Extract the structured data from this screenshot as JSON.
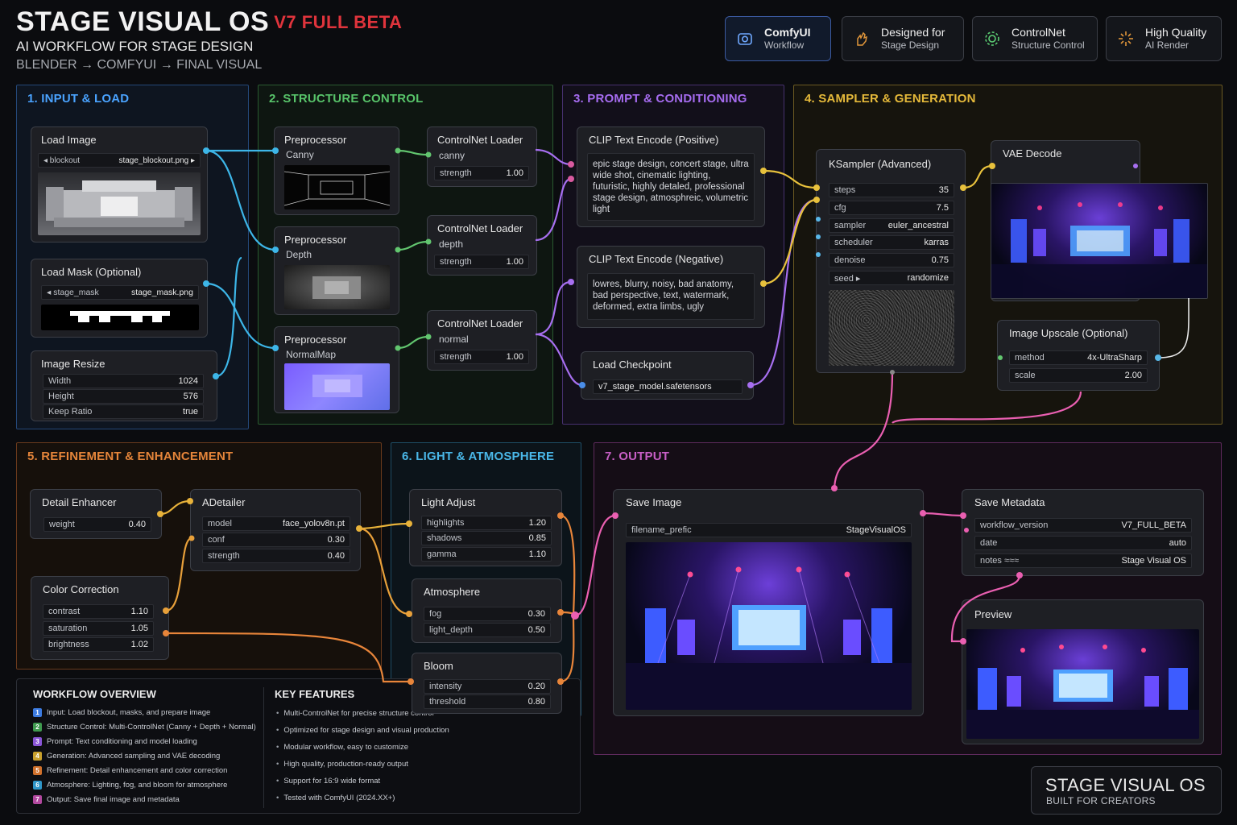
{
  "header": {
    "title": "STAGE VISUAL OS",
    "beta": "V7 FULL BETA",
    "subtitle": "AI WORKFLOW FOR STAGE DESIGN",
    "pipeline": "BLENDER → COMFYUI → FINAL VISUAL"
  },
  "badges": [
    {
      "title": "ComfyUI",
      "sub": "Workflow",
      "icon": "camera-icon"
    },
    {
      "title": "Designed for",
      "sub": "Stage Design",
      "icon": "hand-icon"
    },
    {
      "title": "ControlNet",
      "sub": "Structure Control",
      "icon": "gear-icon"
    },
    {
      "title": "High Quality",
      "sub": "AI Render",
      "icon": "sparkle-icon"
    }
  ],
  "sections": {
    "s1": "1. INPUT & LOAD",
    "s2": "2. STRUCTURE CONTROL",
    "s3": "3. PROMPT & CONDITIONING",
    "s4": "4. SAMPLER & GENERATION",
    "s5": "5. REFINEMENT & ENHANCEMENT",
    "s6": "6. LIGHT & ATMOSPHERE",
    "s7": "7. OUTPUT"
  },
  "colors": {
    "s1": "#4aa3ff",
    "s2": "#58c46a",
    "s3": "#a66cf0",
    "s4": "#e5b93a",
    "s5": "#e5853a",
    "s6": "#4ab7e8",
    "s7": "#c85fc6"
  },
  "nodes": {
    "load_image": {
      "title": "Load Image",
      "left": "◂ blockout",
      "file": "stage_blockout.png ▸"
    },
    "load_mask": {
      "title": "Load Mask (Optional)",
      "left": "◂ stage_mask",
      "file": "stage_mask.png"
    },
    "image_resize": {
      "title": "Image Resize",
      "rows": [
        [
          "Width",
          "1024"
        ],
        [
          "Height",
          "576"
        ],
        [
          "Keep Ratio",
          "true"
        ]
      ]
    },
    "pre_canny": {
      "title": "Preprocessor",
      "sub": "Canny"
    },
    "pre_depth": {
      "title": "Preprocessor",
      "sub": "Depth"
    },
    "pre_normal": {
      "title": "Preprocessor",
      "sub": "NormalMap"
    },
    "cn_canny": {
      "title": "ControlNet Loader",
      "sub": "canny",
      "k": "strength",
      "v": "1.00"
    },
    "cn_depth": {
      "title": "ControlNet Loader",
      "sub": "depth",
      "k": "strength",
      "v": "1.00"
    },
    "cn_normal": {
      "title": "ControlNet Loader",
      "sub": "normal",
      "k": "strength",
      "v": "1.00"
    },
    "clip_pos": {
      "title": "CLIP Text Encode (Positive)",
      "text": "epic stage design, concert stage, ultra wide shot, cinematic lighting, futuristic, highly detaled, professional stage design, atmosphreic, volumetric light"
    },
    "clip_neg": {
      "title": "CLIP Text Encode (Negative)",
      "text": "lowres, blurry, noisy, bad anatomy, bad perspective, text, watermark, deformed, extra limbs, ugly"
    },
    "checkpoint": {
      "title": "Load Checkpoint",
      "value": "v7_stage_model.safetensors"
    },
    "ksampler": {
      "title": "KSampler (Advanced)",
      "rows": [
        [
          "steps",
          "35"
        ],
        [
          "cfg",
          "7.5"
        ],
        [
          "sampler",
          "euler_ancestral"
        ],
        [
          "scheduler",
          "karras"
        ],
        [
          "denoise",
          "0.75"
        ],
        [
          "seed ▸",
          "randomize"
        ]
      ]
    },
    "vae": {
      "title": "VAE Decode"
    },
    "upscale": {
      "title": "Image Upscale (Optional)",
      "rows": [
        [
          "method",
          "4x-UltraSharp"
        ],
        [
          "scale",
          "2.00"
        ]
      ]
    },
    "detail": {
      "title": "Detail Enhancer",
      "rows": [
        [
          "weight",
          "0.40"
        ]
      ]
    },
    "adetailer": {
      "title": "ADetailer",
      "rows": [
        [
          "model",
          "face_yolov8n.pt"
        ],
        [
          "conf",
          "0.30"
        ],
        [
          "strength",
          "0.40"
        ]
      ]
    },
    "color": {
      "title": "Color Correction",
      "rows": [
        [
          "contrast",
          "1.10"
        ],
        [
          "saturation",
          "1.05"
        ],
        [
          "brightness",
          "1.02"
        ]
      ]
    },
    "light": {
      "title": "Light Adjust",
      "rows": [
        [
          "highlights",
          "1.20"
        ],
        [
          "shadows",
          "0.85"
        ],
        [
          "gamma",
          "1.10"
        ]
      ]
    },
    "atmo": {
      "title": "Atmosphere",
      "rows": [
        [
          "fog",
          "0.30"
        ],
        [
          "light_depth",
          "0.50"
        ]
      ]
    },
    "bloom": {
      "title": "Bloom",
      "rows": [
        [
          "intensity",
          "0.20"
        ],
        [
          "threshold",
          "0.80"
        ]
      ]
    },
    "save": {
      "title": "Save Image",
      "k": "filename_prefic",
      "v": "StageVisualOS"
    },
    "meta": {
      "title": "Save Metadata",
      "rows": [
        [
          "workflow_version",
          "V7_FULL_BETA"
        ],
        [
          "date",
          "auto"
        ],
        [
          "notes ≈≈≈",
          "Stage Visual OS"
        ]
      ]
    },
    "preview": {
      "title": "Preview"
    }
  },
  "overview": {
    "title": "WORKFLOW OVERVIEW",
    "items": [
      {
        "n": "1",
        "t": "Input: Load blockout, masks, and prepare image",
        "c": "#3c7be0"
      },
      {
        "n": "2",
        "t": "Structure Control: Multi-ControlNet (Canny + Depth + Normal)",
        "c": "#3f9a4f"
      },
      {
        "n": "3",
        "t": "Prompt: Text conditioning and model loading",
        "c": "#8a55d6"
      },
      {
        "n": "4",
        "t": "Generation: Advanced sampling and VAE decoding",
        "c": "#c9a02c"
      },
      {
        "n": "5",
        "t": "Refinement: Detail enhancement and color correction",
        "c": "#d0712c"
      },
      {
        "n": "6",
        "t": "Atmosphere: Lighting, fog, and bloom for atmosphere",
        "c": "#2f96c9"
      },
      {
        "n": "7",
        "t": "Output: Save final image and metadata",
        "c": "#b2489f"
      }
    ]
  },
  "features": {
    "title": "KEY FEATURES",
    "items": [
      "Multi-ControlNet for precise structure control",
      "Optimized for stage design and visual production",
      "Modular workflow, easy to customize",
      "High quality, production-ready output",
      "Support for 16:9 wide format",
      "Tested with ComfyUI (2024.XX+)"
    ]
  },
  "brand": {
    "title": "STAGE VISUAL OS",
    "sub": "BUILT FOR CREATORS"
  }
}
